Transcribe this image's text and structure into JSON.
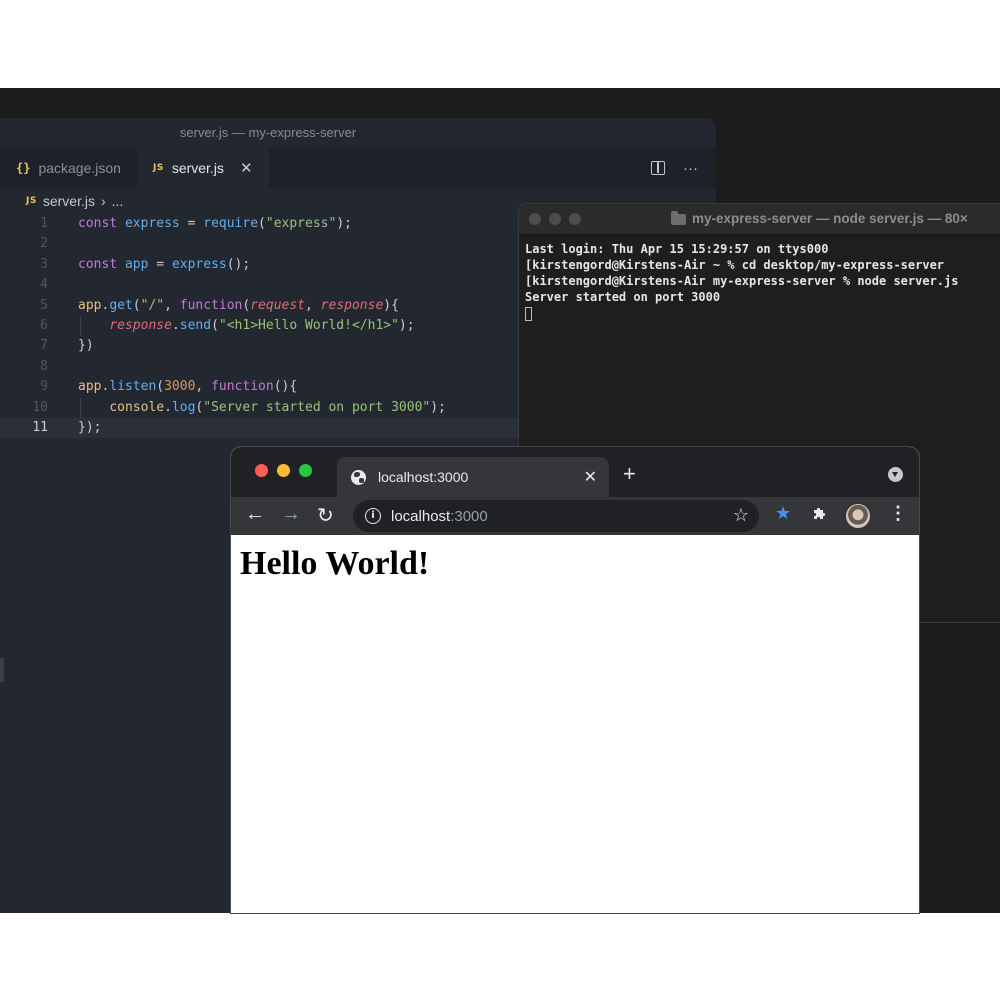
{
  "vscode": {
    "window_title": "server.js — my-express-server",
    "tabs": [
      {
        "label": "package.json",
        "badge": "{}"
      },
      {
        "label": "server.js",
        "badge": "JS"
      }
    ],
    "breadcrumb": {
      "file": "server.js",
      "rest": "..."
    },
    "current_line": 11,
    "code": [
      {
        "n": "1",
        "tokens": [
          [
            "kw",
            "const "
          ],
          [
            "var",
            "express"
          ],
          [
            "pl",
            " = "
          ],
          [
            "fn",
            "require"
          ],
          [
            "pl",
            "("
          ],
          [
            "str",
            "\"express\""
          ],
          [
            "pl",
            ");"
          ]
        ]
      },
      {
        "n": "2",
        "tokens": []
      },
      {
        "n": "3",
        "tokens": [
          [
            "kw",
            "const "
          ],
          [
            "var",
            "app"
          ],
          [
            "pl",
            " = "
          ],
          [
            "fn",
            "express"
          ],
          [
            "pl",
            "();"
          ]
        ]
      },
      {
        "n": "4",
        "tokens": []
      },
      {
        "n": "5",
        "tokens": [
          [
            "obj",
            "app"
          ],
          [
            "pl",
            "."
          ],
          [
            "fn",
            "get"
          ],
          [
            "pl",
            "("
          ],
          [
            "str",
            "\"/\""
          ],
          [
            "pl",
            ", "
          ],
          [
            "kw",
            "function"
          ],
          [
            "pl",
            "("
          ],
          [
            "par",
            "request"
          ],
          [
            "pl",
            ", "
          ],
          [
            "par",
            "response"
          ],
          [
            "pl",
            "){"
          ]
        ]
      },
      {
        "n": "6",
        "tokens": [
          [
            "pl",
            "    "
          ],
          [
            "par",
            "response"
          ],
          [
            "pl",
            "."
          ],
          [
            "fn",
            "send"
          ],
          [
            "pl",
            "("
          ],
          [
            "str",
            "\"<h1>Hello World!</h1>\""
          ],
          [
            "pl",
            ");"
          ]
        ]
      },
      {
        "n": "7",
        "tokens": [
          [
            "pl",
            "})"
          ]
        ]
      },
      {
        "n": "8",
        "tokens": []
      },
      {
        "n": "9",
        "tokens": [
          [
            "obj",
            "app"
          ],
          [
            "pl",
            "."
          ],
          [
            "fn",
            "listen"
          ],
          [
            "pl",
            "("
          ],
          [
            "num",
            "3000"
          ],
          [
            "pl",
            ", "
          ],
          [
            "kw",
            "function"
          ],
          [
            "pl",
            "(){"
          ]
        ]
      },
      {
        "n": "10",
        "tokens": [
          [
            "pl",
            "    "
          ],
          [
            "obj",
            "console"
          ],
          [
            "pl",
            "."
          ],
          [
            "fn",
            "log"
          ],
          [
            "pl",
            "("
          ],
          [
            "str",
            "\"Server started on port 3000\""
          ],
          [
            "pl",
            ");"
          ]
        ]
      },
      {
        "n": "11",
        "tokens": [
          [
            "pl",
            "});"
          ]
        ]
      }
    ]
  },
  "terminal": {
    "title": "my-express-server — node server.js — 80×",
    "lines": [
      "Last login: Thu Apr 15 15:29:57 on ttys000",
      "[kirstengord@Kirstens-Air ~ % cd desktop/my-express-server",
      "[kirstengord@Kirstens-Air my-express-server % node server.js",
      "Server started on port 3000"
    ]
  },
  "browser": {
    "tab_title": "localhost:3000",
    "url_host": "localhost",
    "url_port": ":3000",
    "page_heading": "Hello World!",
    "traffic_lights": [
      "#ff5f57",
      "#febc2e",
      "#28c840"
    ]
  },
  "icons": {
    "split": "split-editor-icon",
    "more": "more-actions-icon",
    "close": "close-icon",
    "back": "back-arrow-icon",
    "forward": "forward-arrow-icon",
    "reload": "reload-icon",
    "info": "site-info-icon",
    "bookmark": "bookmark-star-icon",
    "extension": "extension-puzzle-icon",
    "menu": "kebab-menu-icon",
    "globe": "globe-icon",
    "folder": "folder-icon"
  }
}
